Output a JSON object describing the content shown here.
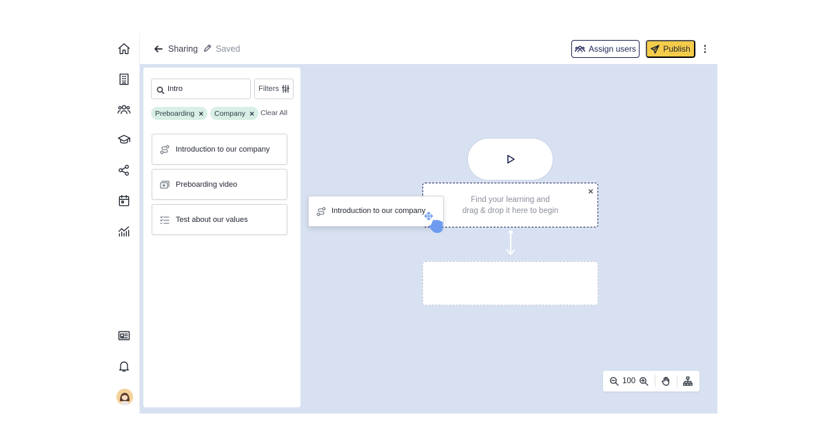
{
  "header": {
    "breadcrumb": "Sharing",
    "status": "Saved",
    "assign_label": "Assign users",
    "publish_label": "Publish"
  },
  "rail": {
    "items": [
      "home-icon",
      "building-icon",
      "users-icon",
      "graduation-cap-icon",
      "share-icon",
      "calendar-icon",
      "analytics-icon"
    ],
    "bottom": [
      "news-icon",
      "bell-icon",
      "avatar"
    ]
  },
  "library": {
    "search": {
      "value": "Intro",
      "placeholder": "Search"
    },
    "filters_label": "Filters",
    "chips": [
      {
        "label": "Preboarding"
      },
      {
        "label": "Company"
      }
    ],
    "clear_all": "Clear All",
    "items": [
      {
        "label": "Introduction to our company",
        "icon": "course-path-icon"
      },
      {
        "label": "Preboarding video",
        "icon": "video-stack-icon"
      },
      {
        "label": "Test about our values",
        "icon": "checklist-icon"
      }
    ]
  },
  "flow": {
    "dropzone_hint": [
      "Find your learning and",
      "drag & drop it here to begin"
    ],
    "dragging_label": "Introduction to our company"
  },
  "zoom": {
    "value": "100"
  },
  "colors": {
    "canvas": "#d7e1f1",
    "navy": "#1c2354",
    "publish": "#f5cc4a",
    "chip": "#d9efe6",
    "drag_hand": "#6e9bf0"
  }
}
